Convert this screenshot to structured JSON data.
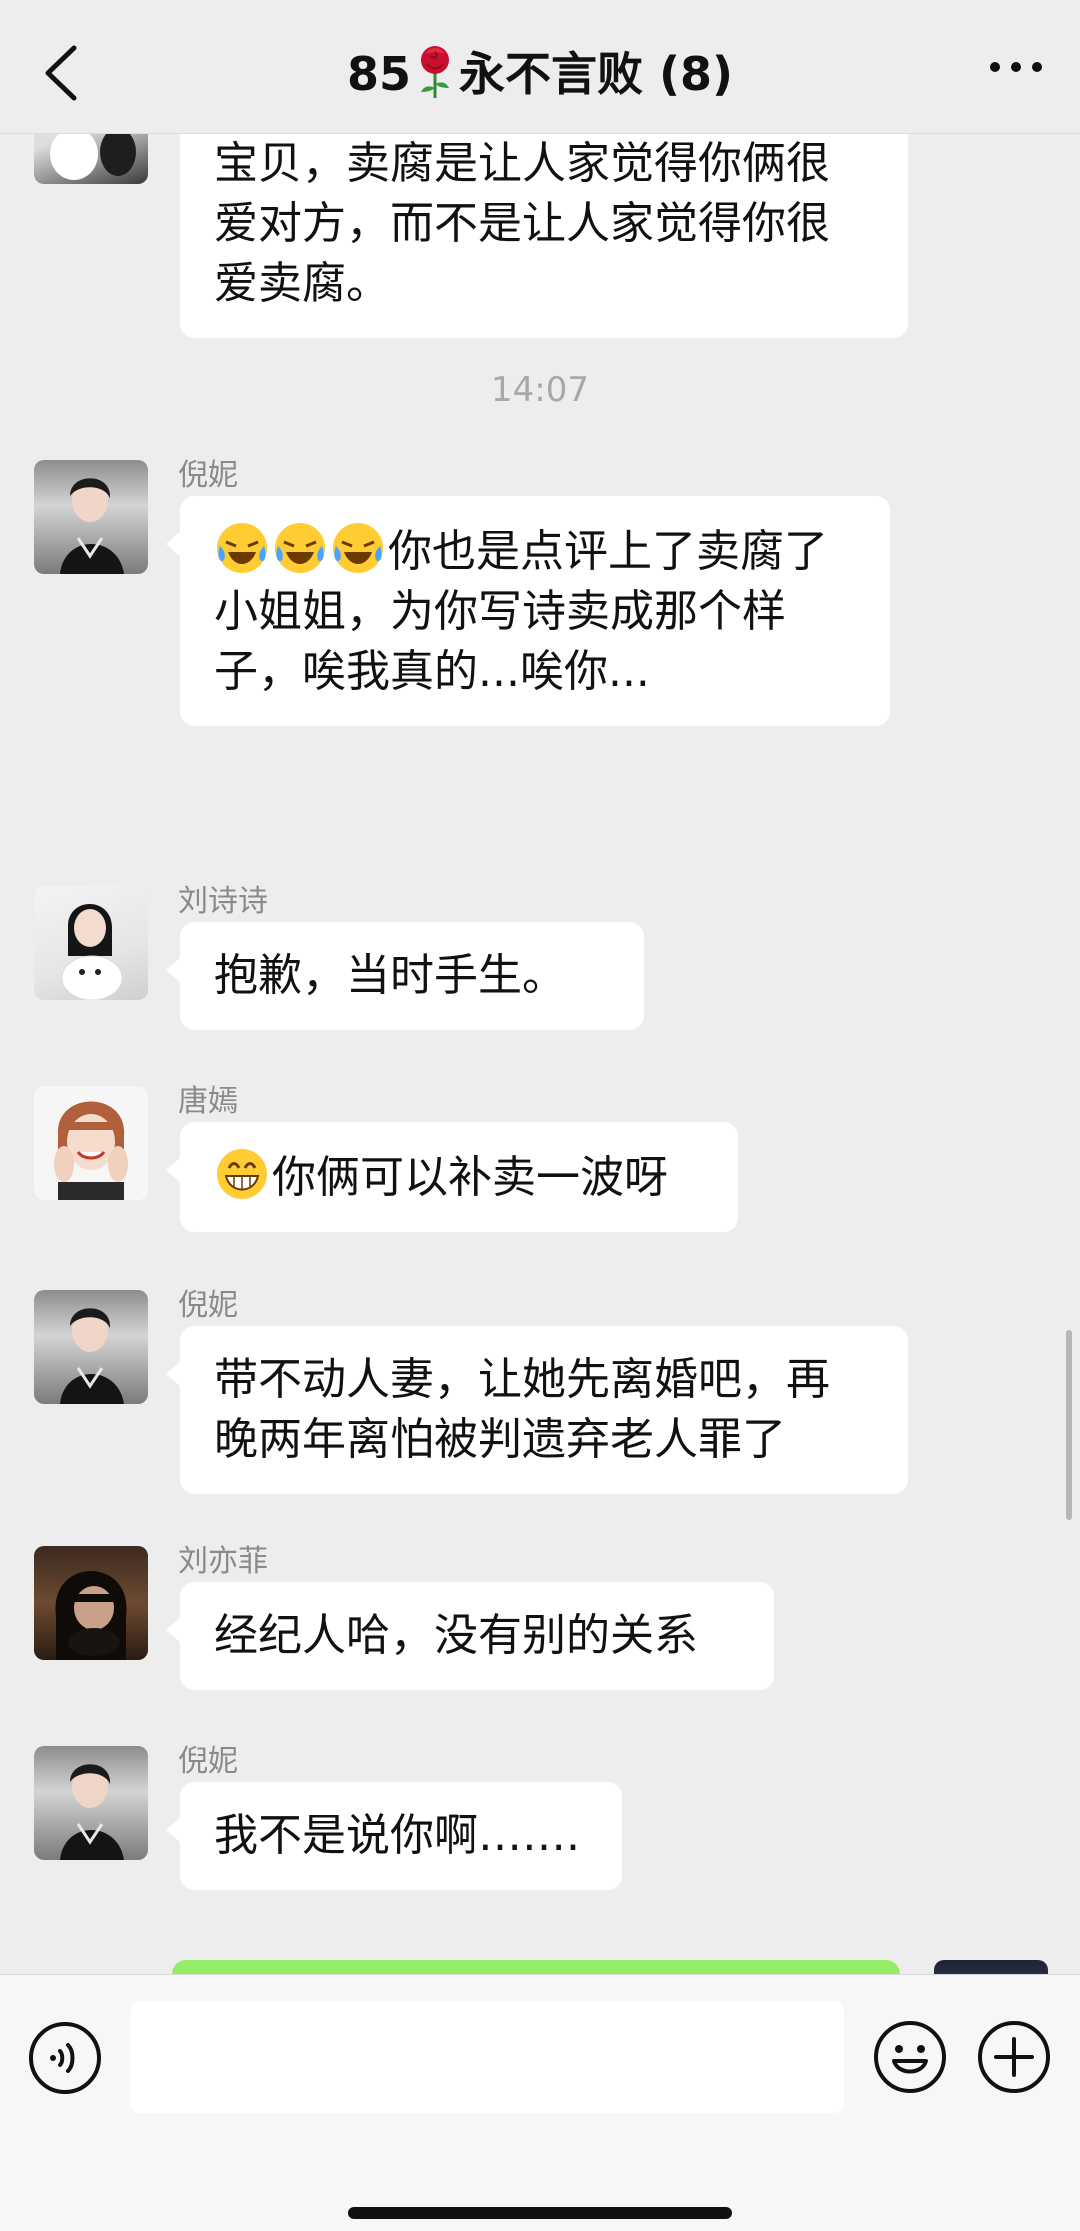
{
  "header": {
    "title_prefix": "85",
    "title_suffix": "永不言败 (8)",
    "rose_icon": "rose-icon"
  },
  "messages": [
    {
      "type": "text",
      "sender": "",
      "lines": [
        "宝贝，卖腐是让人家觉得你俩很",
        "爱对方，而不是让人家觉得你很",
        "爱卖腐。"
      ]
    },
    {
      "type": "time",
      "text": "14:07"
    },
    {
      "type": "text",
      "sender": "倪妮",
      "emoji": "crying-laughing-emoji",
      "lines": [
        "你也是点评上了卖腐了",
        "小姐姐，为你写诗卖成那个样",
        "子，唉我真的...唉你..."
      ]
    },
    {
      "type": "text",
      "sender": "刘诗诗",
      "lines": [
        "抱歉，当时手生。"
      ]
    },
    {
      "type": "text",
      "sender": "唐嫣",
      "emoji": "grinning-emoji",
      "lines": [
        "你俩可以补卖一波呀"
      ]
    },
    {
      "type": "text",
      "sender": "倪妮",
      "lines": [
        "带不动人妻，让她先离婚吧，再",
        "晚两年离怕被判遗弃老人罪了"
      ]
    },
    {
      "type": "text",
      "sender": "刘亦菲",
      "lines": [
        "经纪人哈，没有别的关系"
      ]
    },
    {
      "type": "text",
      "sender": "倪妮",
      "lines": [
        "我不是说你啊……."
      ]
    }
  ],
  "colors": {
    "background": "#ededed",
    "bubble_incoming": "#ffffff",
    "bubble_outgoing": "#95ec69",
    "sender_name": "#8a8a8a"
  },
  "bottom_bar": {
    "input_value": "",
    "voice_icon": "voice-icon",
    "emoji_icon": "emoji-icon",
    "plus_icon": "plus-icon"
  }
}
